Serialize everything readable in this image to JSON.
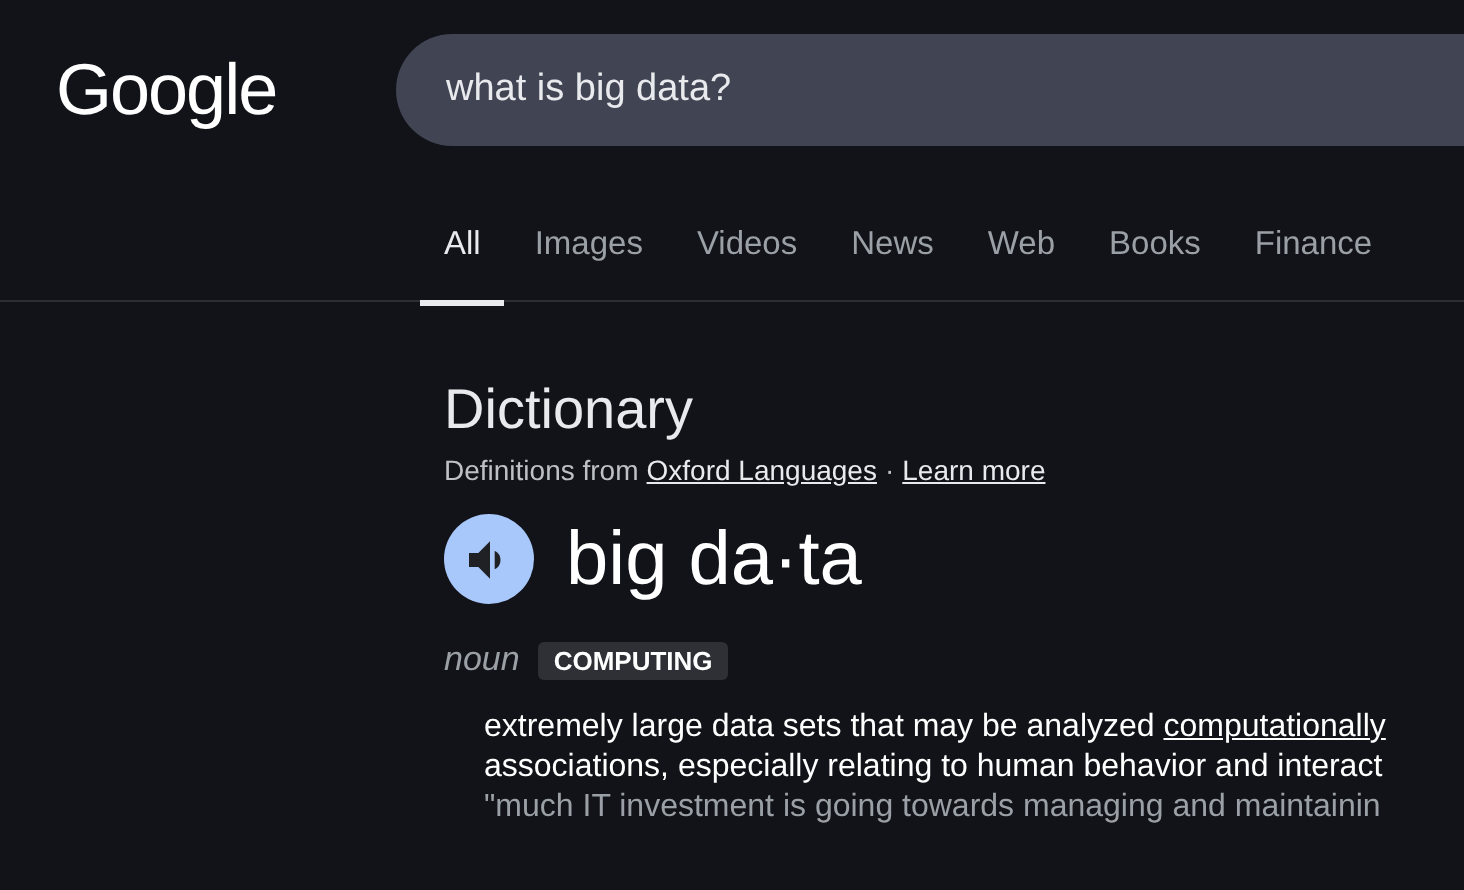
{
  "logo": "Google",
  "search": {
    "value": "what is big data?"
  },
  "tabs": [
    {
      "label": "All",
      "selected": true
    },
    {
      "label": "Images",
      "selected": false
    },
    {
      "label": "Videos",
      "selected": false
    },
    {
      "label": "News",
      "selected": false
    },
    {
      "label": "Web",
      "selected": false
    },
    {
      "label": "Books",
      "selected": false
    },
    {
      "label": "Finance",
      "selected": false
    }
  ],
  "dictionary": {
    "title": "Dictionary",
    "source_prefix": "Definitions from",
    "source_link": "Oxford Languages",
    "separator": "·",
    "learn_more": "Learn more",
    "word": "big da·ta",
    "part_of_speech": "noun",
    "label": "COMPUTING",
    "definition_line_1": {
      "text": "extremely large data sets that may be analyzed",
      "link": "computationally"
    },
    "definition_line_2": "associations, especially relating to human behavior and interact",
    "example": "\"much IT investment is going towards managing and maintainin"
  }
}
